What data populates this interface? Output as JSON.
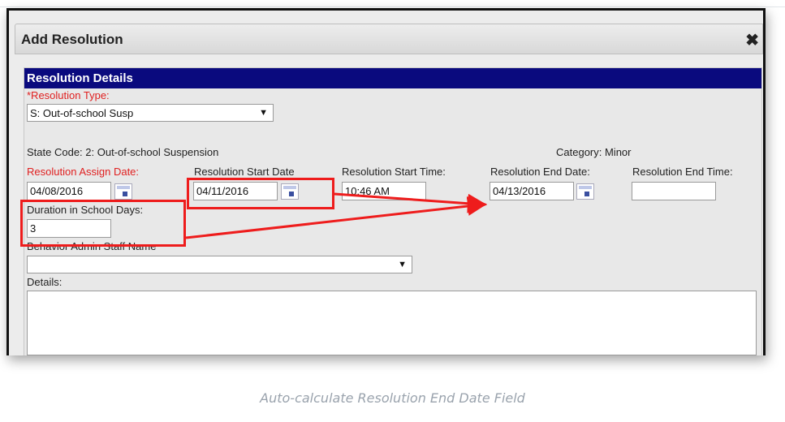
{
  "dialog": {
    "title": "Add Resolution",
    "close_glyph": "✖"
  },
  "panel": {
    "heading": "Resolution Details",
    "resolution_type": {
      "label": "*Resolution Type:",
      "value": "S: Out-of-school Susp"
    },
    "state_code": "State Code: 2: Out-of-school Suspension",
    "category": "Category: Minor",
    "assign_date": {
      "label": "Resolution Assign Date:",
      "value": "04/08/2016"
    },
    "start_date": {
      "label": "Resolution Start Date",
      "value": "04/11/2016"
    },
    "start_time": {
      "label": "Resolution Start Time:",
      "value": "10:46 AM"
    },
    "end_date": {
      "label": "Resolution End Date:",
      "value": "04/13/2016"
    },
    "end_time": {
      "label": "Resolution End Time:",
      "value": ""
    },
    "duration": {
      "label": "Duration in School Days:",
      "value": "3"
    },
    "staff": {
      "label": "Behavior Admin Staff Name",
      "value": ""
    },
    "details": {
      "label": "Details:",
      "value": ""
    }
  },
  "icons": {
    "calendar": "calendar-icon",
    "dropdown": "chevron-down-icon",
    "close": "close-icon"
  },
  "colors": {
    "header_bg": "#0a0a7e",
    "required_label": "#e02020",
    "highlight": "#ee1c1c"
  },
  "caption": "Auto-calculate Resolution End Date Field"
}
